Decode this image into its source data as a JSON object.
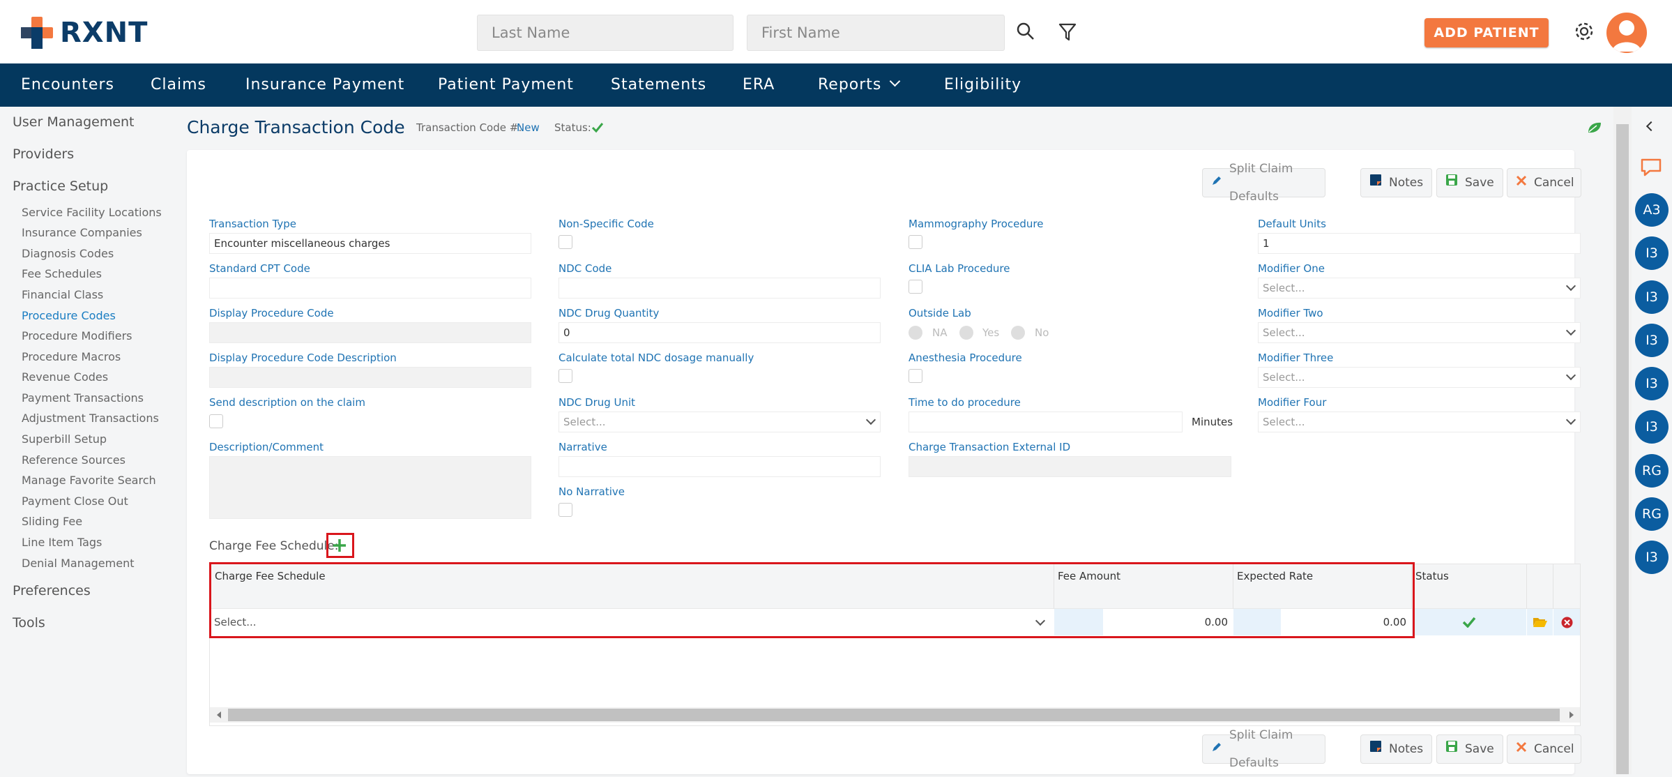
{
  "brand": {
    "name": "RXNT",
    "colors": {
      "orange": "#f3783f",
      "navy": "#04385e",
      "blue": "#1f73b3"
    }
  },
  "search": {
    "last_name_placeholder": "Last Name",
    "first_name_placeholder": "First Name"
  },
  "header": {
    "add_patient": "ADD PATIENT"
  },
  "nav": [
    "Encounters",
    "Claims",
    "Insurance Payment",
    "Patient Payment",
    "Statements",
    "ERA",
    "Reports",
    "Eligibility"
  ],
  "sidebar": {
    "user_management": "User Management",
    "providers": "Providers",
    "practice_setup": "Practice Setup",
    "items": [
      "Service Facility Locations",
      "Insurance Companies",
      "Diagnosis Codes",
      "Fee Schedules",
      "Financial Class",
      "Procedure Codes",
      "Procedure Modifiers",
      "Procedure Macros",
      "Revenue Codes",
      "Payment Transactions",
      "Adjustment Transactions",
      "Superbill Setup",
      "Reference Sources",
      "Manage Favorite Search",
      "Payment Close Out",
      "Sliding Fee",
      "Line Item Tags",
      "Denial Management"
    ],
    "preferences": "Preferences",
    "tools": "Tools"
  },
  "page": {
    "title": "Charge Transaction Code",
    "code_label": "Transaction Code #:",
    "code_value": "New",
    "status_label": "Status:"
  },
  "toolbar": {
    "split": "Split Claim Defaults",
    "notes": "Notes",
    "save": "Save",
    "cancel": "Cancel"
  },
  "form": {
    "transaction_type": {
      "label": "Transaction Type",
      "value": "Encounter miscellaneous charges"
    },
    "standard_cpt": {
      "label": "Standard CPT Code"
    },
    "display_code": {
      "label": "Display Procedure Code"
    },
    "display_desc": {
      "label": "Display Procedure Code Description"
    },
    "send_desc": {
      "label": "Send description on the claim"
    },
    "description": {
      "label": "Description/Comment"
    },
    "non_specific": {
      "label": "Non-Specific Code"
    },
    "ndc_code": {
      "label": "NDC Code"
    },
    "ndc_qty": {
      "label": "NDC Drug Quantity",
      "value": "0"
    },
    "calc_ndc": {
      "label": "Calculate total NDC dosage manually"
    },
    "ndc_unit": {
      "label": "NDC Drug Unit",
      "value": "Select..."
    },
    "narrative": {
      "label": "Narrative"
    },
    "no_narrative": {
      "label": "No Narrative"
    },
    "mammo": {
      "label": "Mammography Procedure"
    },
    "clia": {
      "label": "CLIA Lab Procedure"
    },
    "outside_lab": {
      "label": "Outside Lab",
      "options": [
        "NA",
        "Yes",
        "No"
      ]
    },
    "anesthesia": {
      "label": "Anesthesia Procedure"
    },
    "time_proc": {
      "label": "Time to do procedure",
      "unit": "Minutes"
    },
    "external_id": {
      "label": "Charge Transaction External ID"
    },
    "default_units": {
      "label": "Default Units",
      "value": "1"
    },
    "mod1": {
      "label": "Modifier One",
      "value": "Select..."
    },
    "mod2": {
      "label": "Modifier Two",
      "value": "Select..."
    },
    "mod3": {
      "label": "Modifier Three",
      "value": "Select..."
    },
    "mod4": {
      "label": "Modifier Four",
      "value": "Select..."
    }
  },
  "fee_schedule": {
    "label": "Charge Fee Schedule:",
    "columns": [
      "Charge Fee Schedule",
      "Fee Amount",
      "Expected Rate",
      "Status"
    ],
    "row": {
      "schedule": "Select...",
      "fee": "0.00",
      "rate": "0.00"
    }
  },
  "rail": {
    "avatars": [
      "A3",
      "I3",
      "I3",
      "I3",
      "I3",
      "I3",
      "RG",
      "RG",
      "I3"
    ]
  }
}
